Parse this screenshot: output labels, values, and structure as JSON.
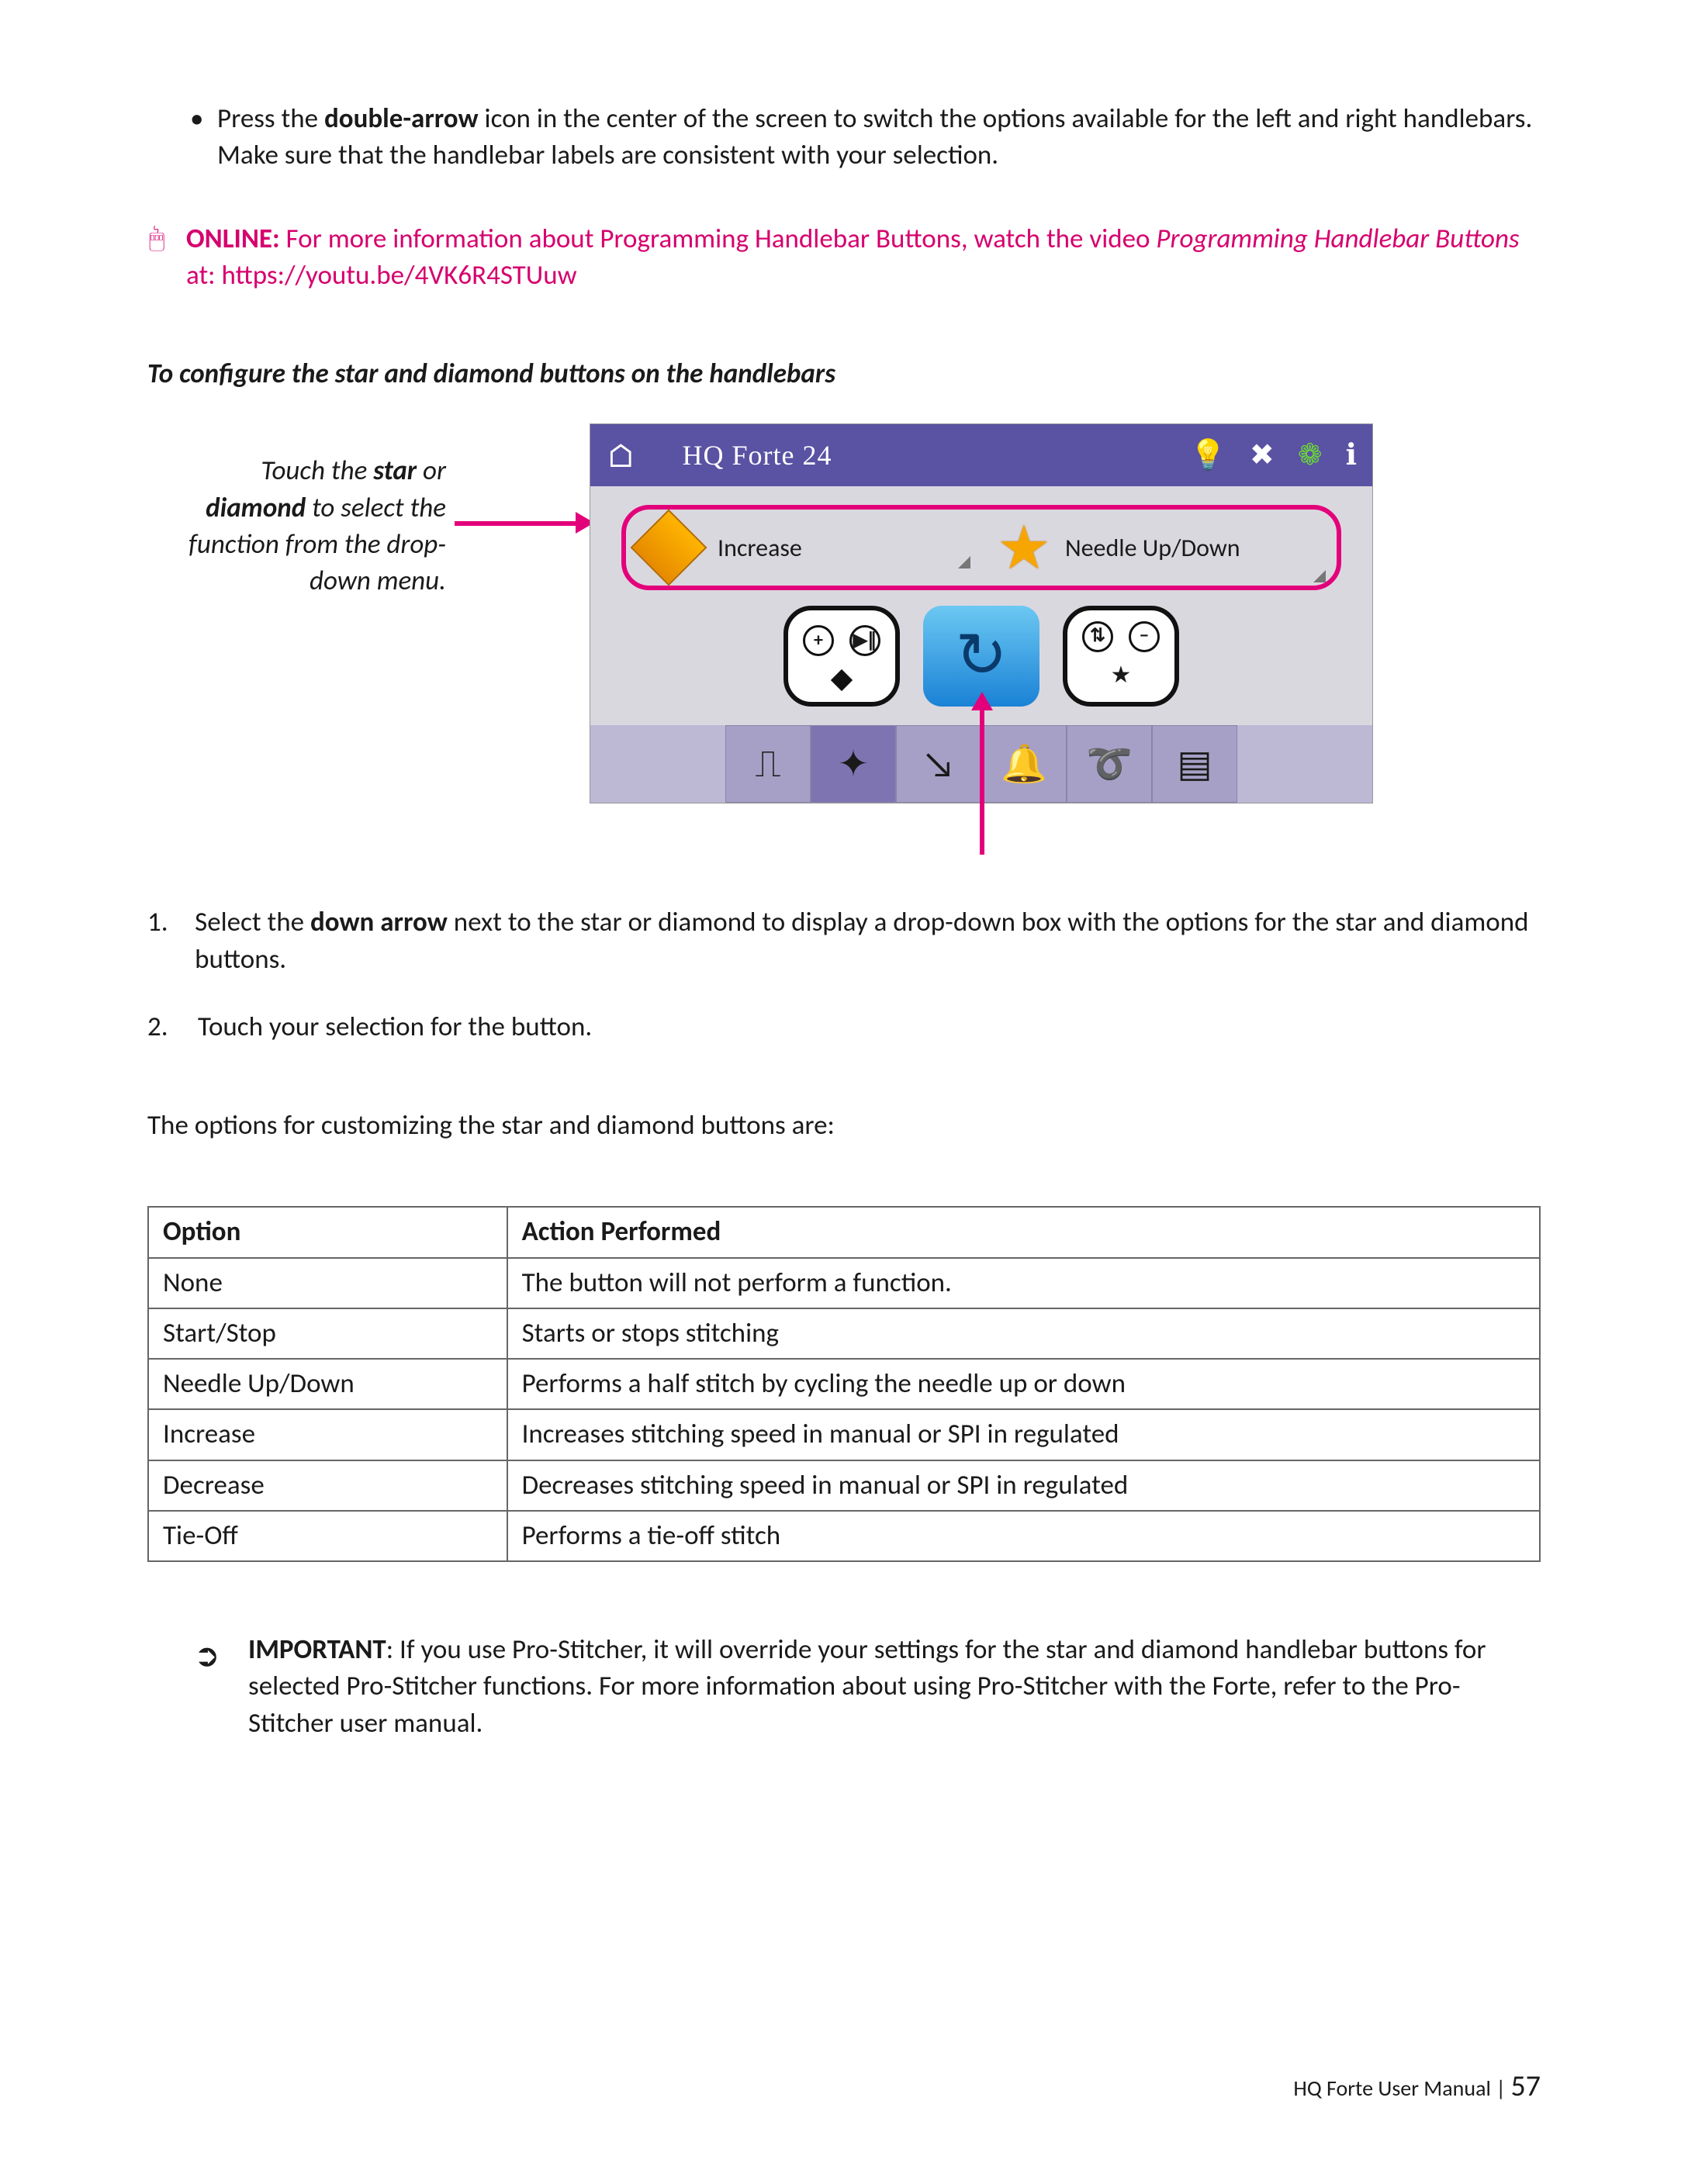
{
  "bullet": {
    "pre": "Press the ",
    "bold": "double-arrow",
    "post": " icon in the center of the screen to switch the options available for the left and right handlebars. Make sure that the handlebar labels are consistent with your selection."
  },
  "online": {
    "label": "ONLINE:",
    "text1": " For more information about Programming Handlebar Buttons, watch the video ",
    "italic": "Programming Handlebar Buttons",
    "text2": " at: ",
    "url": "https://youtu.be/4VK6R4STUuw"
  },
  "section_heading": "To configure the star and diamond buttons on the handlebars",
  "callout": {
    "l1a": "Touch the ",
    "l1b": "star",
    "l1c": " or ",
    "l2a": "diamond",
    "l2b": " to select the function from the drop-down menu."
  },
  "screenshot": {
    "title": "HQ Forte 24",
    "diamond_label": "Increase",
    "star_label": "Needle Up/Down"
  },
  "steps": [
    {
      "n": "1.",
      "pre": "Select the ",
      "bold": "down arrow",
      "post": " next to the star or diamond to display a drop-down box with the options for the star and diamond buttons."
    },
    {
      "n": "2.",
      "pre": "Touch your selection for the button.",
      "bold": "",
      "post": ""
    }
  ],
  "options_intro": "The options for customizing the star and diamond buttons are:",
  "table": {
    "headers": [
      "Option",
      "Action Performed"
    ],
    "rows": [
      [
        "None",
        "The button will not perform a function."
      ],
      [
        "Start/Stop",
        "Starts or stops stitching"
      ],
      [
        "Needle Up/Down",
        "Performs a half stitch by cycling the needle up or down"
      ],
      [
        "Increase",
        "Increases stitching speed in manual or SPI in regulated"
      ],
      [
        "Decrease",
        "Decreases stitching speed in manual or SPI in regulated"
      ],
      [
        "Tie-Off",
        "Performs a tie-off stitch"
      ]
    ]
  },
  "important": {
    "label": "IMPORTANT",
    "text": ": If you use Pro-Stitcher, it will override your settings for the star and diamond handlebar buttons for selected Pro-Stitcher functions. For more information about using Pro-Stitcher with the Forte, refer to the Pro-Stitcher user manual."
  },
  "footer": {
    "title": "HQ Forte User Manual",
    "sep": "  |  ",
    "page": "57"
  }
}
